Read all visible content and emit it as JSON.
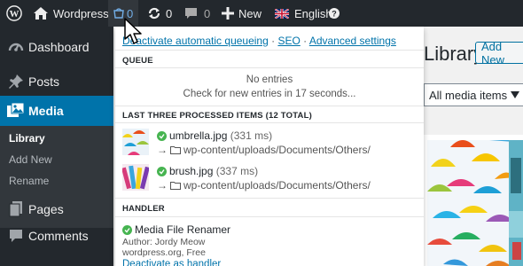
{
  "adminbar": {
    "site_name": "Wordpress",
    "queue_count": "0",
    "updates_count": "0",
    "comments_count": "0",
    "new_label": "New",
    "language_label": "English"
  },
  "sidebar": {
    "items": [
      {
        "label": "Dashboard",
        "icon": "dashboard-icon"
      },
      {
        "label": "Posts",
        "icon": "pin-icon"
      },
      {
        "label": "Media",
        "icon": "media-icon"
      },
      {
        "label": "Pages",
        "icon": "page-icon"
      },
      {
        "label": "Comments",
        "icon": "comment-icon"
      }
    ],
    "submenu": [
      "Library",
      "Add New",
      "Rename"
    ]
  },
  "main": {
    "title": "Library",
    "add_new_label": "Add New",
    "filter_value": "All media items"
  },
  "dropdown": {
    "links": [
      "Deactivate automatic queueing",
      "SEO",
      "Advanced settings"
    ],
    "queue_heading": "QUEUE",
    "queue_empty": "No entries",
    "queue_check": "Check for new entries in 17 seconds...",
    "processed_heading": "LAST THREE PROCESSED ITEMS (12 TOTAL)",
    "processed": [
      {
        "name": "umbrella.jpg",
        "time": "(331 ms)",
        "path": "wp-content/uploads/Documents/Others/"
      },
      {
        "name": "brush.jpg",
        "time": "(337 ms)",
        "path": "wp-content/uploads/Documents/Others/"
      }
    ],
    "handler_heading": "HANDLER",
    "handler_name": "Media File Renamer",
    "handler_author": "Author: Jordy Meow",
    "handler_site": "wordpress.org, Free",
    "handler_action": "Deactivate as handler"
  },
  "colors": {
    "adminbar_bg": "#23282d",
    "accent": "#0073aa",
    "check_green": "#46b450"
  }
}
